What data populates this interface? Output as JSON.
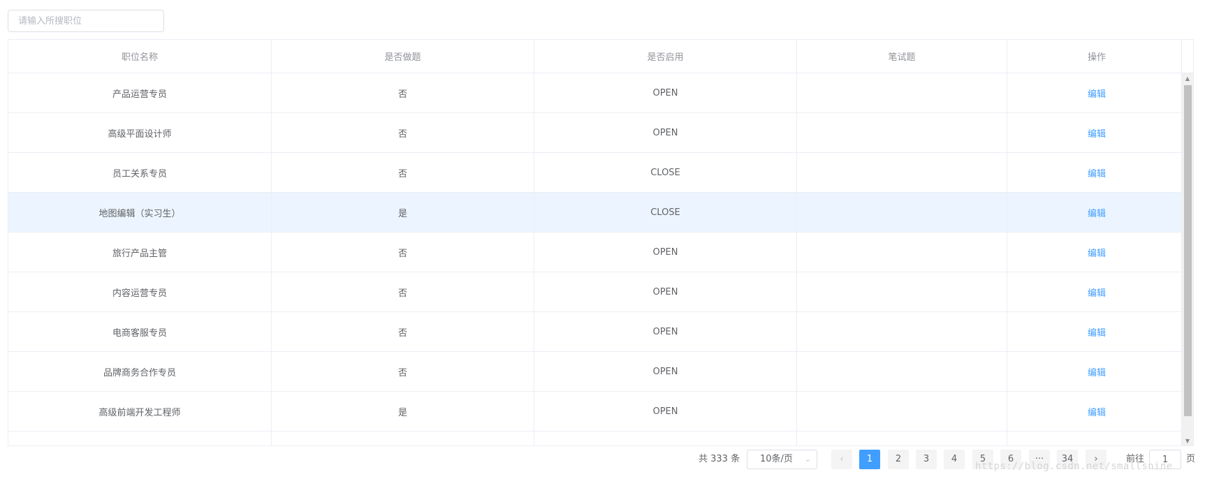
{
  "search": {
    "placeholder": "请输入所搜职位"
  },
  "table": {
    "columns": [
      "职位名称",
      "是否做题",
      "是否启用",
      "笔试题",
      "操作"
    ],
    "rows": [
      {
        "name": "产品运营专员",
        "quiz": "否",
        "status": "OPEN",
        "exam": "",
        "action": "编辑"
      },
      {
        "name": "高级平面设计师",
        "quiz": "否",
        "status": "OPEN",
        "exam": "",
        "action": "编辑"
      },
      {
        "name": "员工关系专员",
        "quiz": "否",
        "status": "CLOSE",
        "exam": "",
        "action": "编辑"
      },
      {
        "name": "地图编辑（实习生）",
        "quiz": "是",
        "status": "CLOSE",
        "exam": "",
        "action": "编辑"
      },
      {
        "name": "旅行产品主管",
        "quiz": "否",
        "status": "OPEN",
        "exam": "",
        "action": "编辑"
      },
      {
        "name": "内容运营专员",
        "quiz": "否",
        "status": "OPEN",
        "exam": "",
        "action": "编辑"
      },
      {
        "name": "电商客服专员",
        "quiz": "否",
        "status": "OPEN",
        "exam": "",
        "action": "编辑"
      },
      {
        "name": "品牌商务合作专员",
        "quiz": "否",
        "status": "OPEN",
        "exam": "",
        "action": "编辑"
      },
      {
        "name": "高级前端开发工程师",
        "quiz": "是",
        "status": "OPEN",
        "exam": "",
        "action": "编辑"
      },
      {
        "name": "",
        "quiz": "",
        "status": "",
        "exam": "",
        "action": ""
      }
    ]
  },
  "pagination": {
    "total_text": "共 333 条",
    "page_size": "10条/页",
    "pages": [
      "1",
      "2",
      "3",
      "4",
      "5",
      "6",
      "···",
      "34"
    ],
    "current_page": "1",
    "goto_label": "前往",
    "goto_value": "1",
    "goto_suffix": "页"
  },
  "watermark": "https://blog.csdn.net/smallsnine",
  "colors": {
    "primary": "#409eff",
    "row_highlight": "#ecf5ff",
    "border": "#ebeef5"
  }
}
